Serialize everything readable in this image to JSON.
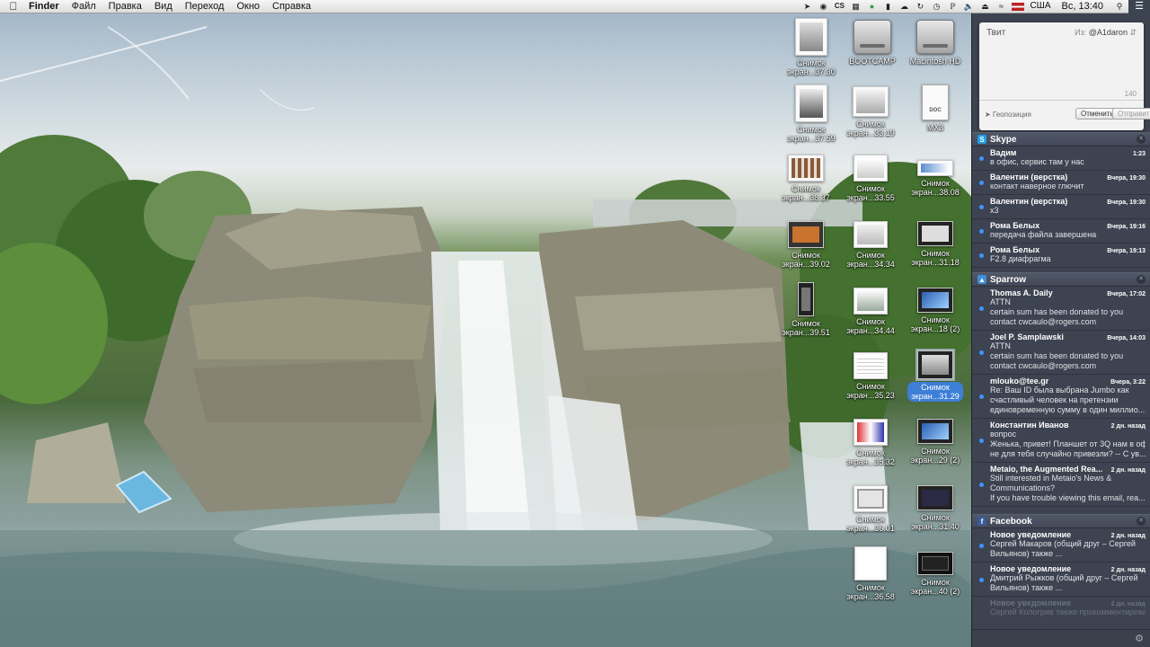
{
  "menubar": {
    "app": "Finder",
    "menus": [
      "Файл",
      "Правка",
      "Вид",
      "Переход",
      "Окно",
      "Справка"
    ],
    "status_icons": [
      "cursor-icon",
      "cs-icon",
      "cs-icon",
      "evernote-icon",
      "battery-icon",
      "dropbox-icon",
      "sync-icon",
      "time-machine-icon",
      "bluetooth-icon",
      "volume-icon",
      "eject-icon",
      "wifi-icon"
    ],
    "cs_label": "CS",
    "input_source": "США",
    "clock": "Вс, 13:40"
  },
  "desktop": {
    "icons": [
      {
        "label_top": "Снимок",
        "label_bottom": "экран...37.30",
        "kind": "screenshot"
      },
      {
        "label_top": "BOOTCAMP",
        "label_bottom": "",
        "kind": "disk"
      },
      {
        "label_top": "Macintosh HD",
        "label_bottom": "",
        "kind": "disk"
      },
      {
        "label_top": "Снимок",
        "label_bottom": "экран...37.59",
        "kind": "screenshot"
      },
      {
        "label_top": "Снимок",
        "label_bottom": "экран...33.19",
        "kind": "screenshot"
      },
      {
        "label_top": "MX3",
        "label_bottom": "",
        "kind": "doc",
        "doc_tag": "DOC"
      },
      {
        "label_top": "Снимок",
        "label_bottom": "экран...38.37",
        "kind": "screenshot"
      },
      {
        "label_top": "Снимок",
        "label_bottom": "экран...33.55",
        "kind": "screenshot"
      },
      {
        "label_top": "Снимок",
        "label_bottom": "экран...38.08",
        "kind": "screenshot"
      },
      {
        "label_top": "Снимок",
        "label_bottom": "экран...39.02",
        "kind": "screenshot"
      },
      {
        "label_top": "Снимок",
        "label_bottom": "экран...34.34",
        "kind": "screenshot"
      },
      {
        "label_top": "Снимок",
        "label_bottom": "экран...31.18",
        "kind": "screenshot"
      },
      {
        "label_top": "Снимок",
        "label_bottom": "экран...39.51",
        "kind": "screenshot"
      },
      {
        "label_top": "Снимок",
        "label_bottom": "экран...34.44",
        "kind": "screenshot"
      },
      {
        "label_top": "Снимок",
        "label_bottom": "экран...18 (2)",
        "kind": "screenshot"
      },
      {
        "label_top": "Снимок",
        "label_bottom": "экран...35.23",
        "kind": "screenshot"
      },
      {
        "label_top": "Снимок",
        "label_bottom": "экран...31.29",
        "kind": "screenshot",
        "selected": true
      },
      {
        "label_top": "Снимок",
        "label_bottom": "экран...35.32",
        "kind": "screenshot"
      },
      {
        "label_top": "Снимок",
        "label_bottom": "экран...29 (2)",
        "kind": "screenshot"
      },
      {
        "label_top": "Снимок",
        "label_bottom": "экран...36.01",
        "kind": "screenshot"
      },
      {
        "label_top": "Снимок",
        "label_bottom": "экран...31.40",
        "kind": "screenshot"
      },
      {
        "label_top": "Снимок",
        "label_bottom": "экран...36.58",
        "kind": "screenshot"
      },
      {
        "label_top": "Снимок",
        "label_bottom": "экран...40 (2)",
        "kind": "screenshot"
      }
    ]
  },
  "notification_center": {
    "tweet": {
      "title": "Твит",
      "from_label": "Из:",
      "from_account": "@A1daron",
      "char_count": "140",
      "geo_label": "Геопозиция",
      "cancel_label": "Отменить",
      "send_label": "Отправить"
    },
    "sections": [
      {
        "app": "Skype",
        "icon_glyph": "S",
        "icon_color": "#1c9ee8",
        "items": [
          {
            "title": "Вадим",
            "time": "1:23",
            "body": [
              "в офис, сервис там у нас"
            ]
          },
          {
            "title": "Валентин (верстка)",
            "time": "Вчера, 19:30",
            "body": [
              "контакт наверное глючит"
            ]
          },
          {
            "title": "Валентин (верстка)",
            "time": "Вчера, 19:30",
            "body": [
              "х3"
            ]
          },
          {
            "title": "Рома Белых",
            "time": "Вчера, 19:16",
            "body": [
              "передача файла завершена"
            ]
          },
          {
            "title": "Рома Белых",
            "time": "Вчера, 19:13",
            "body": [
              "F2.8 диафрагма"
            ]
          }
        ]
      },
      {
        "app": "Sparrow",
        "icon_glyph": "▲",
        "icon_color": "#3e8fd8",
        "items": [
          {
            "title": "Thomas A. Daily",
            "time": "Вчера, 17:02",
            "body": [
              "ATTN",
              "certain sum has been donated to you",
              "contact cwcaulo@rogers.com"
            ]
          },
          {
            "title": "Joel P. Samplawski",
            "time": "Вчера, 14:03",
            "body": [
              "ATTN",
              "certain sum has been donated to you",
              "contact cwcaulo@rogers.com"
            ]
          },
          {
            "title": "mlouko@tee.gr",
            "time": "Вчера, 3:22",
            "body": [
              "Re: Ваш ID была выбрана Jumbo как",
              "счастливый человек на претензии",
              "единовременную сумму в один миллио..."
            ]
          },
          {
            "title": "Константин Иванов",
            "time": "2 дн. назад",
            "body": [
              "вопрос",
              "Женька, привет! Планшет от 3Q нам в офис",
              "не для тебя случайно привезли? -- С ув..."
            ]
          },
          {
            "title": "Metaio, the Augmented Rea...",
            "time": "2 дн. назад",
            "body": [
              "Still interested in Metaio's News &",
              "Communications?",
              "If you have trouble viewing this email, rea..."
            ]
          }
        ]
      },
      {
        "app": "Facebook",
        "icon_glyph": "f",
        "icon_color": "#3b5998",
        "items": [
          {
            "title": "Новое уведомление",
            "time": "2 дн. назад",
            "body": [
              "Сергей Макаров (общий друг – Сергей",
              "Вильянов) также ..."
            ]
          },
          {
            "title": "Новое уведомление",
            "time": "2 дн. назад",
            "body": [
              "Дмитрий Рыжков (общий друг – Сергей",
              "Вильянов) также ..."
            ]
          },
          {
            "title": "Новое уведомление",
            "time": "2 дн. назад",
            "body": [
              "Сергей Кологрив также прокомментировал"
            ],
            "faded": true
          }
        ]
      }
    ]
  }
}
